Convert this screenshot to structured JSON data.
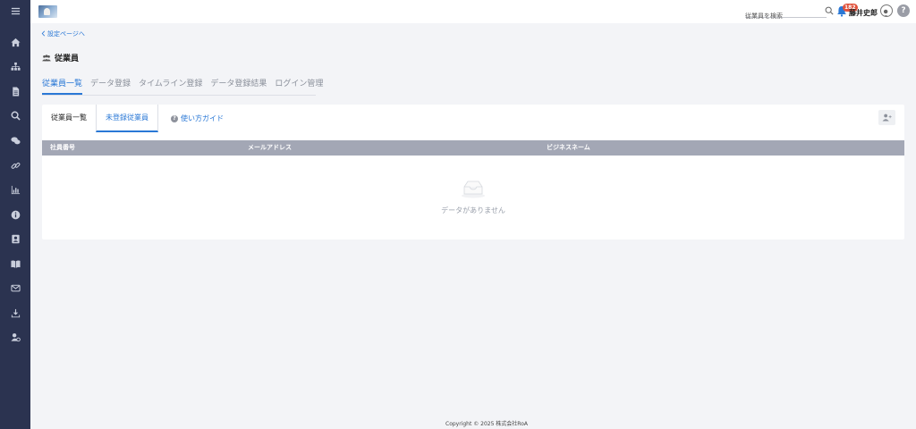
{
  "sidebar": {
    "items": [
      {
        "icon": "menu-icon"
      },
      {
        "icon": "home-icon"
      },
      {
        "icon": "org-chart-icon"
      },
      {
        "icon": "document-icon"
      },
      {
        "icon": "search-icon"
      },
      {
        "icon": "chat-icon"
      },
      {
        "icon": "link-icon"
      },
      {
        "icon": "bar-chart-icon"
      },
      {
        "icon": "info-icon"
      },
      {
        "icon": "contact-card-icon"
      },
      {
        "icon": "book-icon"
      },
      {
        "icon": "mail-icon"
      },
      {
        "icon": "download-icon"
      },
      {
        "icon": "user-settings-icon"
      }
    ]
  },
  "header": {
    "search_placeholder": "従業員を検索",
    "notification_count": "182",
    "user_name": "藤井史郎",
    "help_label": "?"
  },
  "nav": {
    "back_link": "設定ページへ"
  },
  "page": {
    "title": "従業員"
  },
  "top_tabs": [
    {
      "label": "従業員一覧",
      "active": true
    },
    {
      "label": "データ登録",
      "active": false
    },
    {
      "label": "タイムライン登録",
      "active": false
    },
    {
      "label": "データ登録結果",
      "active": false
    },
    {
      "label": "ログイン管理",
      "active": false
    }
  ],
  "sub_tabs": {
    "list": "従業員一覧",
    "unregistered": "未登録従業員",
    "guide": "使い方ガイド",
    "guide_icon": "?"
  },
  "table": {
    "columns": [
      "社員番号",
      "メールアドレス",
      "ビジネスネーム"
    ],
    "rows": [],
    "empty_text": "データがありません"
  },
  "footer": {
    "text": "Copyright © 2025 株式会社RoA"
  },
  "colors": {
    "sidebar": "#2b3350",
    "accent": "#2a78d6",
    "table_header": "#a3a7b5",
    "badge": "#e0533d"
  }
}
